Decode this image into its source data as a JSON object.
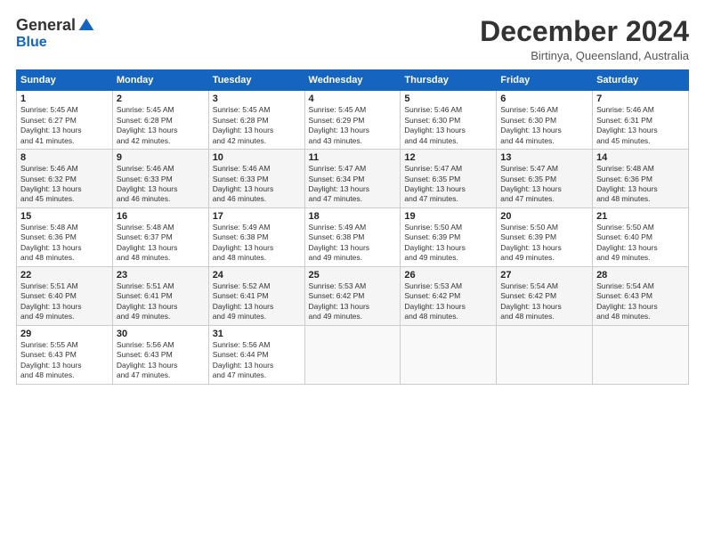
{
  "logo": {
    "general": "General",
    "blue": "Blue"
  },
  "header": {
    "title": "December 2024",
    "subtitle": "Birtinya, Queensland, Australia"
  },
  "days_of_week": [
    "Sunday",
    "Monday",
    "Tuesday",
    "Wednesday",
    "Thursday",
    "Friday",
    "Saturday"
  ],
  "weeks": [
    [
      {
        "day": "1",
        "sunrise": "5:45 AM",
        "sunset": "6:27 PM",
        "daylight": "13 hours and 41 minutes."
      },
      {
        "day": "2",
        "sunrise": "5:45 AM",
        "sunset": "6:28 PM",
        "daylight": "13 hours and 42 minutes."
      },
      {
        "day": "3",
        "sunrise": "5:45 AM",
        "sunset": "6:28 PM",
        "daylight": "13 hours and 42 minutes."
      },
      {
        "day": "4",
        "sunrise": "5:45 AM",
        "sunset": "6:29 PM",
        "daylight": "13 hours and 43 minutes."
      },
      {
        "day": "5",
        "sunrise": "5:46 AM",
        "sunset": "6:30 PM",
        "daylight": "13 hours and 44 minutes."
      },
      {
        "day": "6",
        "sunrise": "5:46 AM",
        "sunset": "6:30 PM",
        "daylight": "13 hours and 44 minutes."
      },
      {
        "day": "7",
        "sunrise": "5:46 AM",
        "sunset": "6:31 PM",
        "daylight": "13 hours and 45 minutes."
      }
    ],
    [
      {
        "day": "8",
        "sunrise": "5:46 AM",
        "sunset": "6:32 PM",
        "daylight": "13 hours and 45 minutes."
      },
      {
        "day": "9",
        "sunrise": "5:46 AM",
        "sunset": "6:33 PM",
        "daylight": "13 hours and 46 minutes."
      },
      {
        "day": "10",
        "sunrise": "5:46 AM",
        "sunset": "6:33 PM",
        "daylight": "13 hours and 46 minutes."
      },
      {
        "day": "11",
        "sunrise": "5:47 AM",
        "sunset": "6:34 PM",
        "daylight": "13 hours and 47 minutes."
      },
      {
        "day": "12",
        "sunrise": "5:47 AM",
        "sunset": "6:35 PM",
        "daylight": "13 hours and 47 minutes."
      },
      {
        "day": "13",
        "sunrise": "5:47 AM",
        "sunset": "6:35 PM",
        "daylight": "13 hours and 47 minutes."
      },
      {
        "day": "14",
        "sunrise": "5:48 AM",
        "sunset": "6:36 PM",
        "daylight": "13 hours and 48 minutes."
      }
    ],
    [
      {
        "day": "15",
        "sunrise": "5:48 AM",
        "sunset": "6:36 PM",
        "daylight": "13 hours and 48 minutes."
      },
      {
        "day": "16",
        "sunrise": "5:48 AM",
        "sunset": "6:37 PM",
        "daylight": "13 hours and 48 minutes."
      },
      {
        "day": "17",
        "sunrise": "5:49 AM",
        "sunset": "6:38 PM",
        "daylight": "13 hours and 48 minutes."
      },
      {
        "day": "18",
        "sunrise": "5:49 AM",
        "sunset": "6:38 PM",
        "daylight": "13 hours and 49 minutes."
      },
      {
        "day": "19",
        "sunrise": "5:50 AM",
        "sunset": "6:39 PM",
        "daylight": "13 hours and 49 minutes."
      },
      {
        "day": "20",
        "sunrise": "5:50 AM",
        "sunset": "6:39 PM",
        "daylight": "13 hours and 49 minutes."
      },
      {
        "day": "21",
        "sunrise": "5:50 AM",
        "sunset": "6:40 PM",
        "daylight": "13 hours and 49 minutes."
      }
    ],
    [
      {
        "day": "22",
        "sunrise": "5:51 AM",
        "sunset": "6:40 PM",
        "daylight": "13 hours and 49 minutes."
      },
      {
        "day": "23",
        "sunrise": "5:51 AM",
        "sunset": "6:41 PM",
        "daylight": "13 hours and 49 minutes."
      },
      {
        "day": "24",
        "sunrise": "5:52 AM",
        "sunset": "6:41 PM",
        "daylight": "13 hours and 49 minutes."
      },
      {
        "day": "25",
        "sunrise": "5:53 AM",
        "sunset": "6:42 PM",
        "daylight": "13 hours and 49 minutes."
      },
      {
        "day": "26",
        "sunrise": "5:53 AM",
        "sunset": "6:42 PM",
        "daylight": "13 hours and 48 minutes."
      },
      {
        "day": "27",
        "sunrise": "5:54 AM",
        "sunset": "6:42 PM",
        "daylight": "13 hours and 48 minutes."
      },
      {
        "day": "28",
        "sunrise": "5:54 AM",
        "sunset": "6:43 PM",
        "daylight": "13 hours and 48 minutes."
      }
    ],
    [
      {
        "day": "29",
        "sunrise": "5:55 AM",
        "sunset": "6:43 PM",
        "daylight": "13 hours and 48 minutes."
      },
      {
        "day": "30",
        "sunrise": "5:56 AM",
        "sunset": "6:43 PM",
        "daylight": "13 hours and 47 minutes."
      },
      {
        "day": "31",
        "sunrise": "5:56 AM",
        "sunset": "6:44 PM",
        "daylight": "13 hours and 47 minutes."
      },
      null,
      null,
      null,
      null
    ]
  ],
  "labels": {
    "sunrise": "Sunrise:",
    "sunset": "Sunset:",
    "daylight": "Daylight:"
  }
}
